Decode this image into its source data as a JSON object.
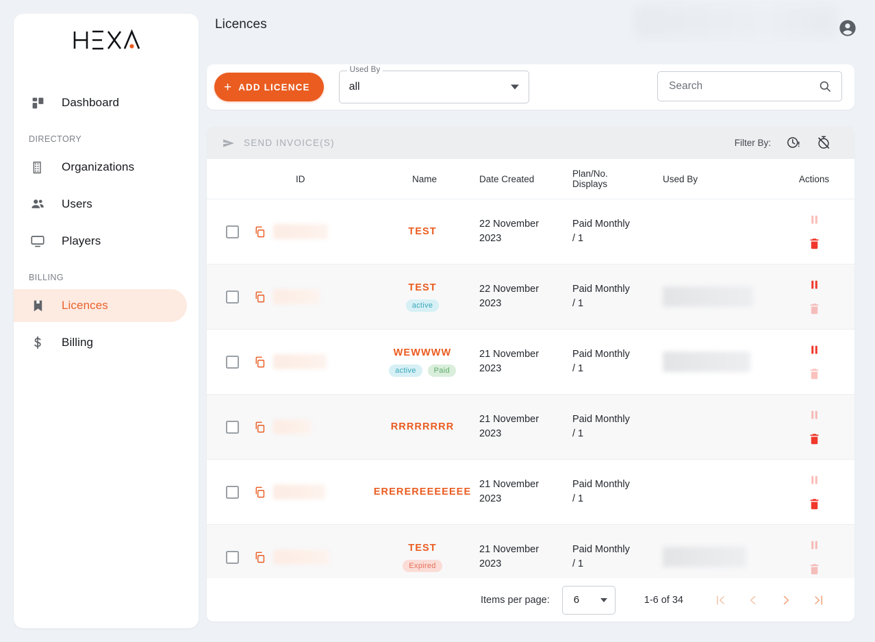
{
  "brand": {
    "name": "HEXA",
    "accent": "#ea5c20",
    "dot_color": "#ea5c20"
  },
  "header": {
    "title": "Licences",
    "avatar_icon": "account-circle-icon"
  },
  "sidebar": {
    "items": [
      {
        "label": "Dashboard",
        "icon": "dashboard-icon",
        "active": false,
        "section": null
      },
      {
        "label": "Organizations",
        "icon": "organizations-icon",
        "active": false,
        "section": "DIRECTORY"
      },
      {
        "label": "Users",
        "icon": "users-icon",
        "active": false,
        "section": null
      },
      {
        "label": "Players",
        "icon": "players-monitor-icon",
        "active": false,
        "section": null
      },
      {
        "label": "Licences",
        "icon": "licences-bookmark-icon",
        "active": true,
        "section": "BILLING"
      },
      {
        "label": "Billing",
        "icon": "billing-dollar-icon",
        "active": false,
        "section": null
      }
    ],
    "sections": {
      "directory": "DIRECTORY",
      "billing": "BILLING"
    }
  },
  "toolbar": {
    "add_licence_label": "ADD LICENCE",
    "add_icon": "plus-icon",
    "used_by": {
      "label": "Used By",
      "value": "all",
      "arrow_icon": "chevron-down-icon"
    },
    "search": {
      "placeholder": "Search",
      "value": "",
      "icon": "search-icon"
    }
  },
  "table_actionbar": {
    "send_invoice_label": "SEND INVOICE(S)",
    "send_icon": "send-plane-icon",
    "filter_by_label": "Filter By:",
    "filter_icons": [
      {
        "name": "pending-clock-icon"
      },
      {
        "name": "timer-off-icon"
      }
    ]
  },
  "table": {
    "columns": [
      "",
      "ID",
      "Name",
      "Date Created",
      "Plan/No. Displays",
      "Used By",
      "Actions"
    ],
    "column_headers": {
      "id": "ID",
      "name": "Name",
      "date_created": "Date Created",
      "plan_line1": "Plan/No.",
      "plan_line2": "Displays",
      "used_by": "Used By",
      "actions": "Actions"
    },
    "rows": [
      {
        "checked": false,
        "id_redacted": true,
        "name": "TEST",
        "badges": [],
        "date_created": "22 November 2023",
        "date_line1": "22 November",
        "date_line2": "2023",
        "plan_line1": "Paid Monthly",
        "plan_line2": "/ 1",
        "used_by_redacted": false,
        "actions": {
          "pause": "pause-icon",
          "delete": "delete-trash-icon",
          "pause_enabled": false,
          "delete_enabled": true
        }
      },
      {
        "checked": false,
        "id_redacted": true,
        "name": "TEST",
        "badges": [
          {
            "label": "active",
            "type": "active"
          }
        ],
        "date_created": "22 November 2023",
        "date_line1": "22 November",
        "date_line2": "2023",
        "plan_line1": "Paid Monthly",
        "plan_line2": "/ 1",
        "used_by_redacted": true,
        "actions": {
          "pause": "pause-icon",
          "delete": "delete-trash-icon",
          "pause_enabled": true,
          "delete_enabled": false
        }
      },
      {
        "checked": false,
        "id_redacted": true,
        "name": "WEWWWW",
        "badges": [
          {
            "label": "active",
            "type": "active"
          },
          {
            "label": "Paid",
            "type": "paid"
          }
        ],
        "date_created": "21 November 2023",
        "date_line1": "21 November",
        "date_line2": "2023",
        "plan_line1": "Paid Monthly",
        "plan_line2": "/ 1",
        "used_by_redacted": true,
        "actions": {
          "pause": "pause-icon",
          "delete": "delete-trash-icon",
          "pause_enabled": true,
          "delete_enabled": false
        }
      },
      {
        "checked": false,
        "id_redacted": true,
        "name": "RRRRRRRR",
        "badges": [],
        "date_created": "21 November 2023",
        "date_line1": "21 November",
        "date_line2": "2023",
        "plan_line1": "Paid Monthly",
        "plan_line2": "/ 1",
        "used_by_redacted": false,
        "actions": {
          "pause": "pause-icon",
          "delete": "delete-trash-icon",
          "pause_enabled": false,
          "delete_enabled": true
        }
      },
      {
        "checked": false,
        "id_redacted": true,
        "name": "EREREREEEEEEE",
        "badges": [],
        "date_created": "21 November 2023",
        "date_line1": "21 November",
        "date_line2": "2023",
        "plan_line1": "Paid Monthly",
        "plan_line2": "/ 1",
        "used_by_redacted": false,
        "actions": {
          "pause": "pause-icon",
          "delete": "delete-trash-icon",
          "pause_enabled": false,
          "delete_enabled": true
        }
      },
      {
        "checked": false,
        "id_redacted": true,
        "name": "TEST",
        "badges": [
          {
            "label": "Expired",
            "type": "expired"
          }
        ],
        "date_created": "21 November 2023",
        "date_line1": "21 November",
        "date_line2": "2023",
        "plan_line1": "Paid Monthly",
        "plan_line2": "/ 1",
        "used_by_redacted": true,
        "actions": {
          "pause": "pause-icon",
          "delete": "delete-trash-icon",
          "pause_enabled": false,
          "delete_enabled": false
        }
      }
    ]
  },
  "paginator": {
    "items_per_page_label": "Items per page:",
    "items_per_page_value": "6",
    "range_label": "1-6 of 34",
    "buttons": [
      {
        "name": "first-page-button",
        "icon": "first-page-icon",
        "enabled": false
      },
      {
        "name": "previous-page-button",
        "icon": "chevron-left-icon",
        "enabled": false
      },
      {
        "name": "next-page-button",
        "icon": "chevron-right-icon",
        "enabled": true
      },
      {
        "name": "last-page-button",
        "icon": "last-page-icon",
        "enabled": true
      }
    ]
  }
}
